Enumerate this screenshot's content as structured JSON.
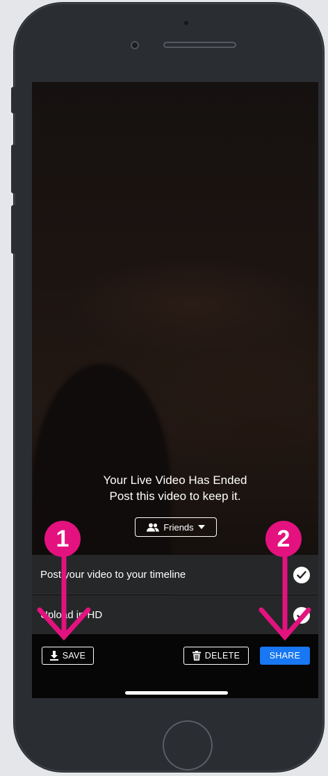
{
  "video_ended": {
    "heading": "Your Live Video Has Ended",
    "subheading": "Post this video to keep it."
  },
  "audience": {
    "label": "Friends",
    "icon": "friends-icon"
  },
  "options": [
    {
      "label": "Post your video to your timeline",
      "checked": true
    },
    {
      "label": "Upload in HD",
      "checked": true
    }
  ],
  "actions": {
    "save_label": "SAVE",
    "delete_label": "DELETE",
    "share_label": "SHARE"
  },
  "annotations": {
    "step1": "1",
    "step2": "2"
  },
  "colors": {
    "share_blue": "#1877f2",
    "annotation_pink": "#e3127f"
  }
}
